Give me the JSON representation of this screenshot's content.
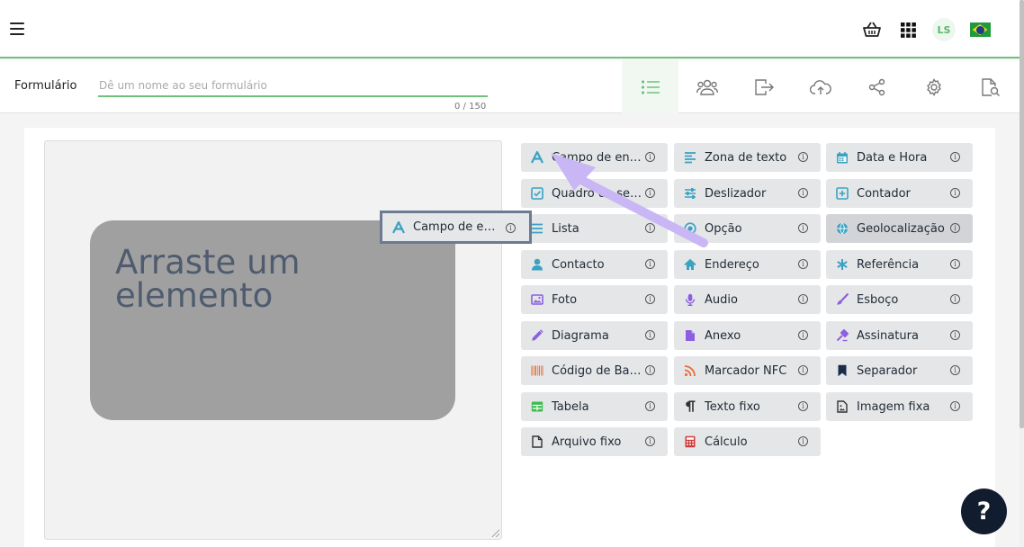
{
  "topbar": {
    "avatar_initials": "LS",
    "icons": [
      "hamburger-icon",
      "basket-icon",
      "apps-grid-icon",
      "avatar",
      "brazil-flag-icon"
    ]
  },
  "form": {
    "label": "Formulário",
    "name_placeholder": "Dê um nome ao seu formulário",
    "name_value": "",
    "counter": "0 / 150",
    "tabs": [
      "list-icon",
      "users-icon",
      "export-icon",
      "cloud-upload-icon",
      "share-icon",
      "settings-gear-icon",
      "preview-search-icon"
    ],
    "active_tab": 0
  },
  "canvas": {
    "drag_prompt": "Arraste um elemento"
  },
  "dragging_element": {
    "label": "Campo de entr...",
    "icon": "text-a-icon"
  },
  "elements": [
    {
      "label": "Campo de entr...",
      "icon": "text-a-icon",
      "color": "#3aa2c2"
    },
    {
      "label": "Zona de texto",
      "icon": "text-lines-icon",
      "color": "#3aa2c2"
    },
    {
      "label": "Data e Hora",
      "icon": "calendar-icon",
      "color": "#3aa2c2"
    },
    {
      "label": "Quadro de sele...",
      "icon": "checkbox-icon",
      "color": "#3aa2c2"
    },
    {
      "label": "Deslizador",
      "icon": "sliders-icon",
      "color": "#3aa2c2"
    },
    {
      "label": "Contador",
      "icon": "plus-box-icon",
      "color": "#3aa2c2"
    },
    {
      "label": "Lista",
      "icon": "list-icon",
      "color": "#3aa2c2"
    },
    {
      "label": "Opção",
      "icon": "radio-icon",
      "color": "#3aa2c2"
    },
    {
      "label": "Geolocalização",
      "icon": "globe-icon",
      "color": "#3aa2c2"
    },
    {
      "label": "Contacto",
      "icon": "person-icon",
      "color": "#3aa2c2"
    },
    {
      "label": "Endereço",
      "icon": "home-icon",
      "color": "#3aa2c2"
    },
    {
      "label": "Referência",
      "icon": "asterisk-icon",
      "color": "#3aa2c2"
    },
    {
      "label": "Foto",
      "icon": "image-icon",
      "color": "#8c5fe0"
    },
    {
      "label": "Áudio",
      "icon": "microphone-icon",
      "color": "#8c5fe0"
    },
    {
      "label": "Esboço",
      "icon": "brush-icon",
      "color": "#8c5fe0"
    },
    {
      "label": "Diagrama",
      "icon": "pencil-icon",
      "color": "#8c5fe0"
    },
    {
      "label": "Anexo",
      "icon": "file-icon",
      "color": "#8c5fe0"
    },
    {
      "label": "Assinatura",
      "icon": "signature-icon",
      "color": "#8c5fe0"
    },
    {
      "label": "Código de Barr...",
      "icon": "barcode-icon",
      "color": "#e8733d"
    },
    {
      "label": "Marcador NFC",
      "icon": "rss-icon",
      "color": "#e8733d"
    },
    {
      "label": "Separador",
      "icon": "bookmark-icon",
      "color": "#1b2c4a"
    },
    {
      "label": "Tabela",
      "icon": "table-icon",
      "color": "#3dbb4f"
    },
    {
      "label": "Texto fixo",
      "icon": "paragraph-icon",
      "color": "#333333"
    },
    {
      "label": "Imagem fixa",
      "icon": "image-file-icon",
      "color": "#333333"
    },
    {
      "label": "Arquivo fixo",
      "icon": "blank-file-icon",
      "color": "#333333"
    },
    {
      "label": "Cálculo",
      "icon": "calculator-icon",
      "color": "#d23a3a"
    }
  ],
  "hovered_element_index": 8,
  "help_button": "?",
  "colors": {
    "accent_green": "#6fc17c",
    "help_button_bg": "#111d2f",
    "arrow": "#c9b7f5"
  }
}
